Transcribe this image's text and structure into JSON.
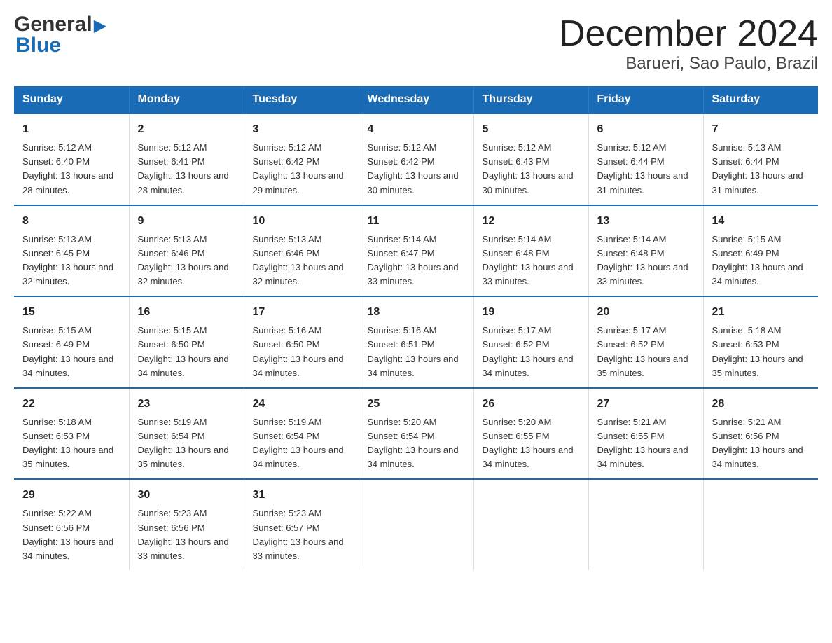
{
  "header": {
    "logo": {
      "general": "General",
      "arrow": "▶",
      "blue": "Blue"
    },
    "title": "December 2024",
    "location": "Barueri, Sao Paulo, Brazil"
  },
  "calendar": {
    "weekdays": [
      "Sunday",
      "Monday",
      "Tuesday",
      "Wednesday",
      "Thursday",
      "Friday",
      "Saturday"
    ],
    "weeks": [
      [
        {
          "day": "1",
          "sunrise": "5:12 AM",
          "sunset": "6:40 PM",
          "daylight": "13 hours and 28 minutes."
        },
        {
          "day": "2",
          "sunrise": "5:12 AM",
          "sunset": "6:41 PM",
          "daylight": "13 hours and 28 minutes."
        },
        {
          "day": "3",
          "sunrise": "5:12 AM",
          "sunset": "6:42 PM",
          "daylight": "13 hours and 29 minutes."
        },
        {
          "day": "4",
          "sunrise": "5:12 AM",
          "sunset": "6:42 PM",
          "daylight": "13 hours and 30 minutes."
        },
        {
          "day": "5",
          "sunrise": "5:12 AM",
          "sunset": "6:43 PM",
          "daylight": "13 hours and 30 minutes."
        },
        {
          "day": "6",
          "sunrise": "5:12 AM",
          "sunset": "6:44 PM",
          "daylight": "13 hours and 31 minutes."
        },
        {
          "day": "7",
          "sunrise": "5:13 AM",
          "sunset": "6:44 PM",
          "daylight": "13 hours and 31 minutes."
        }
      ],
      [
        {
          "day": "8",
          "sunrise": "5:13 AM",
          "sunset": "6:45 PM",
          "daylight": "13 hours and 32 minutes."
        },
        {
          "day": "9",
          "sunrise": "5:13 AM",
          "sunset": "6:46 PM",
          "daylight": "13 hours and 32 minutes."
        },
        {
          "day": "10",
          "sunrise": "5:13 AM",
          "sunset": "6:46 PM",
          "daylight": "13 hours and 32 minutes."
        },
        {
          "day": "11",
          "sunrise": "5:14 AM",
          "sunset": "6:47 PM",
          "daylight": "13 hours and 33 minutes."
        },
        {
          "day": "12",
          "sunrise": "5:14 AM",
          "sunset": "6:48 PM",
          "daylight": "13 hours and 33 minutes."
        },
        {
          "day": "13",
          "sunrise": "5:14 AM",
          "sunset": "6:48 PM",
          "daylight": "13 hours and 33 minutes."
        },
        {
          "day": "14",
          "sunrise": "5:15 AM",
          "sunset": "6:49 PM",
          "daylight": "13 hours and 34 minutes."
        }
      ],
      [
        {
          "day": "15",
          "sunrise": "5:15 AM",
          "sunset": "6:49 PM",
          "daylight": "13 hours and 34 minutes."
        },
        {
          "day": "16",
          "sunrise": "5:15 AM",
          "sunset": "6:50 PM",
          "daylight": "13 hours and 34 minutes."
        },
        {
          "day": "17",
          "sunrise": "5:16 AM",
          "sunset": "6:50 PM",
          "daylight": "13 hours and 34 minutes."
        },
        {
          "day": "18",
          "sunrise": "5:16 AM",
          "sunset": "6:51 PM",
          "daylight": "13 hours and 34 minutes."
        },
        {
          "day": "19",
          "sunrise": "5:17 AM",
          "sunset": "6:52 PM",
          "daylight": "13 hours and 34 minutes."
        },
        {
          "day": "20",
          "sunrise": "5:17 AM",
          "sunset": "6:52 PM",
          "daylight": "13 hours and 35 minutes."
        },
        {
          "day": "21",
          "sunrise": "5:18 AM",
          "sunset": "6:53 PM",
          "daylight": "13 hours and 35 minutes."
        }
      ],
      [
        {
          "day": "22",
          "sunrise": "5:18 AM",
          "sunset": "6:53 PM",
          "daylight": "13 hours and 35 minutes."
        },
        {
          "day": "23",
          "sunrise": "5:19 AM",
          "sunset": "6:54 PM",
          "daylight": "13 hours and 35 minutes."
        },
        {
          "day": "24",
          "sunrise": "5:19 AM",
          "sunset": "6:54 PM",
          "daylight": "13 hours and 34 minutes."
        },
        {
          "day": "25",
          "sunrise": "5:20 AM",
          "sunset": "6:54 PM",
          "daylight": "13 hours and 34 minutes."
        },
        {
          "day": "26",
          "sunrise": "5:20 AM",
          "sunset": "6:55 PM",
          "daylight": "13 hours and 34 minutes."
        },
        {
          "day": "27",
          "sunrise": "5:21 AM",
          "sunset": "6:55 PM",
          "daylight": "13 hours and 34 minutes."
        },
        {
          "day": "28",
          "sunrise": "5:21 AM",
          "sunset": "6:56 PM",
          "daylight": "13 hours and 34 minutes."
        }
      ],
      [
        {
          "day": "29",
          "sunrise": "5:22 AM",
          "sunset": "6:56 PM",
          "daylight": "13 hours and 34 minutes."
        },
        {
          "day": "30",
          "sunrise": "5:23 AM",
          "sunset": "6:56 PM",
          "daylight": "13 hours and 33 minutes."
        },
        {
          "day": "31",
          "sunrise": "5:23 AM",
          "sunset": "6:57 PM",
          "daylight": "13 hours and 33 minutes."
        },
        null,
        null,
        null,
        null
      ]
    ]
  }
}
